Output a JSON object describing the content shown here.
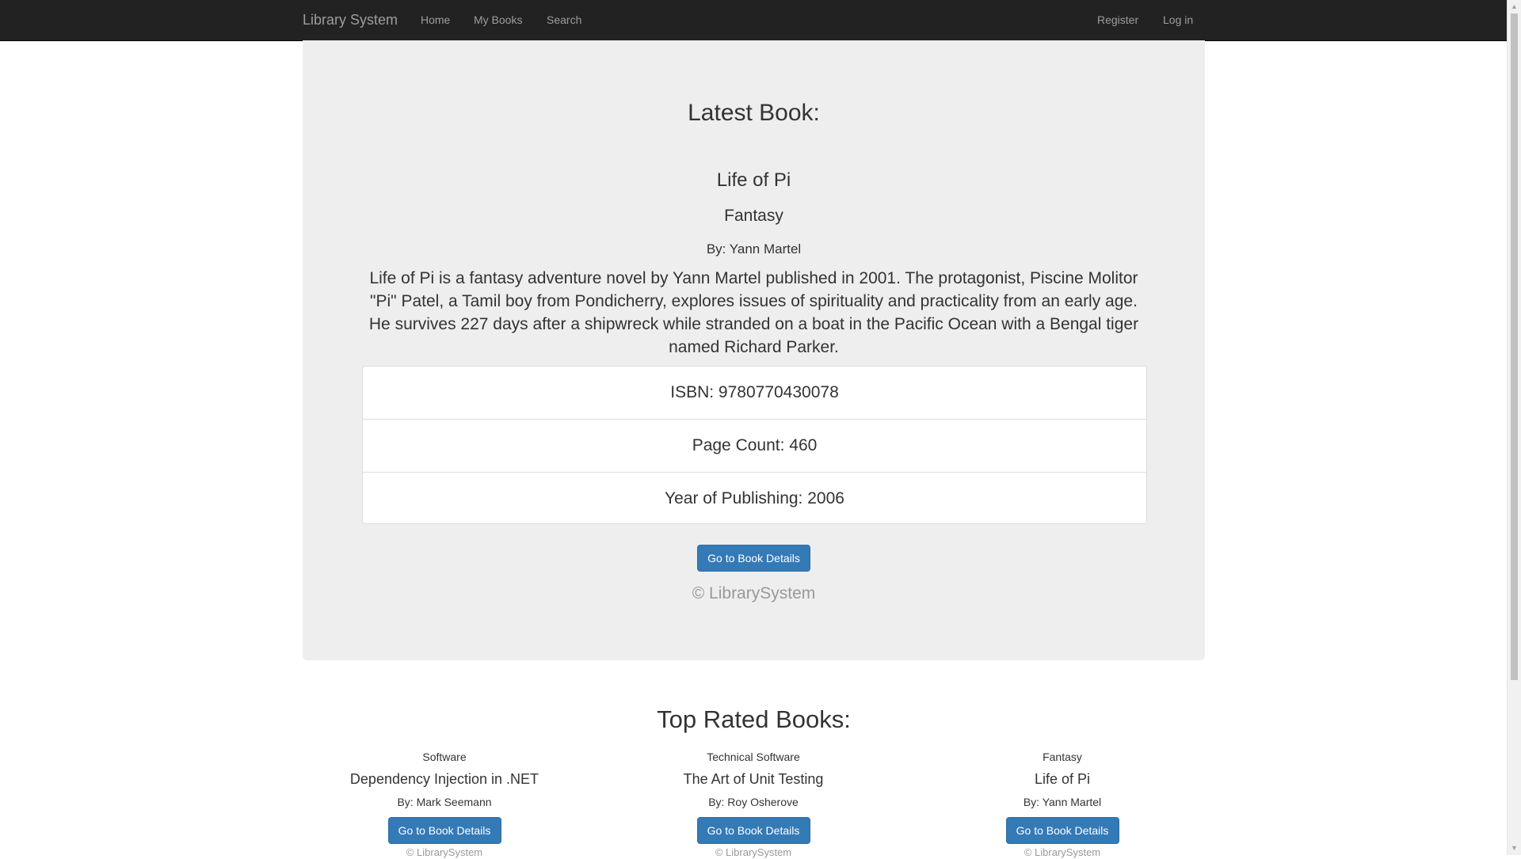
{
  "nav": {
    "brand": "Library System",
    "links": [
      "Home",
      "My Books",
      "Search"
    ],
    "right_links": [
      "Register",
      "Log in"
    ]
  },
  "latest": {
    "heading": "Latest Book:",
    "title": "Life of Pi",
    "genre": "Fantasy",
    "author": "By: Yann Martel",
    "description": "Life of Pi is a fantasy adventure novel by Yann Martel published in 2001. The protagonist, Piscine Molitor \"Pi\" Patel, a Tamil boy from Pondicherry, explores issues of spirituality and practicality from an early age. He survives 227 days after a shipwreck while stranded on a boat in the Pacific Ocean with a Bengal tiger named Richard Parker.",
    "isbn": "ISBN: 9780770430078",
    "page_count": "Page Count: 460",
    "year": "Year of Publishing: 2006",
    "button": "Go to Book Details",
    "copyright": "© LibrarySystem"
  },
  "top_rated": {
    "heading": "Top Rated Books:",
    "books": [
      {
        "genre": "Software",
        "title": "Dependency Injection in .NET",
        "author": "By: Mark Seemann",
        "button": "Go to Book Details",
        "copyright": "© LibrarySystem"
      },
      {
        "genre": "Technical Software",
        "title": "The Art of Unit Testing",
        "author": "By: Roy Osherove",
        "button": "Go to Book Details",
        "copyright": "© LibrarySystem"
      },
      {
        "genre": "Fantasy",
        "title": "Life of Pi",
        "author": "By: Yann Martel",
        "button": "Go to Book Details",
        "copyright": "© LibrarySystem"
      }
    ]
  },
  "colors": {
    "navbar": "#222222",
    "jumbotron": "#eeeeee",
    "primary": "#337ab7"
  }
}
